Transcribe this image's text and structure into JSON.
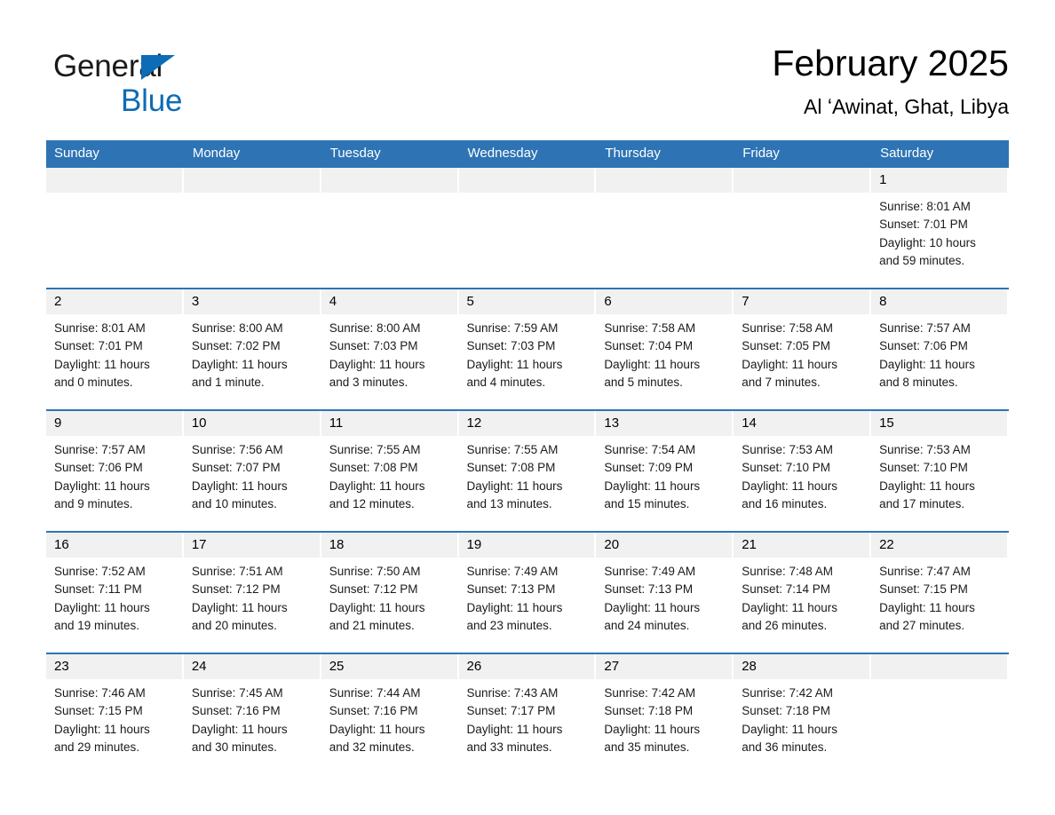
{
  "brand": {
    "name_part1": "General",
    "name_part2": "Blue",
    "triangle_color": "#0d6cb6",
    "accent_color": "#2e74b4"
  },
  "header": {
    "title": "February 2025",
    "subtitle": "Al ʻAwinat, Ghat, Libya"
  },
  "calendar": {
    "weekday_headers": [
      "Sunday",
      "Monday",
      "Tuesday",
      "Wednesday",
      "Thursday",
      "Friday",
      "Saturday"
    ],
    "labels": {
      "sunrise": "Sunrise:",
      "sunset": "Sunset:",
      "daylight": "Daylight:"
    },
    "weeks": [
      [
        {
          "empty": true
        },
        {
          "empty": true
        },
        {
          "empty": true
        },
        {
          "empty": true
        },
        {
          "empty": true
        },
        {
          "empty": true
        },
        {
          "day": "1",
          "sunrise": "Sunrise: 8:01 AM",
          "sunset": "Sunset: 7:01 PM",
          "daylight_line1": "Daylight: 10 hours",
          "daylight_line2": "and 59 minutes."
        }
      ],
      [
        {
          "day": "2",
          "sunrise": "Sunrise: 8:01 AM",
          "sunset": "Sunset: 7:01 PM",
          "daylight_line1": "Daylight: 11 hours",
          "daylight_line2": "and 0 minutes."
        },
        {
          "day": "3",
          "sunrise": "Sunrise: 8:00 AM",
          "sunset": "Sunset: 7:02 PM",
          "daylight_line1": "Daylight: 11 hours",
          "daylight_line2": "and 1 minute."
        },
        {
          "day": "4",
          "sunrise": "Sunrise: 8:00 AM",
          "sunset": "Sunset: 7:03 PM",
          "daylight_line1": "Daylight: 11 hours",
          "daylight_line2": "and 3 minutes."
        },
        {
          "day": "5",
          "sunrise": "Sunrise: 7:59 AM",
          "sunset": "Sunset: 7:03 PM",
          "daylight_line1": "Daylight: 11 hours",
          "daylight_line2": "and 4 minutes."
        },
        {
          "day": "6",
          "sunrise": "Sunrise: 7:58 AM",
          "sunset": "Sunset: 7:04 PM",
          "daylight_line1": "Daylight: 11 hours",
          "daylight_line2": "and 5 minutes."
        },
        {
          "day": "7",
          "sunrise": "Sunrise: 7:58 AM",
          "sunset": "Sunset: 7:05 PM",
          "daylight_line1": "Daylight: 11 hours",
          "daylight_line2": "and 7 minutes."
        },
        {
          "day": "8",
          "sunrise": "Sunrise: 7:57 AM",
          "sunset": "Sunset: 7:06 PM",
          "daylight_line1": "Daylight: 11 hours",
          "daylight_line2": "and 8 minutes."
        }
      ],
      [
        {
          "day": "9",
          "sunrise": "Sunrise: 7:57 AM",
          "sunset": "Sunset: 7:06 PM",
          "daylight_line1": "Daylight: 11 hours",
          "daylight_line2": "and 9 minutes."
        },
        {
          "day": "10",
          "sunrise": "Sunrise: 7:56 AM",
          "sunset": "Sunset: 7:07 PM",
          "daylight_line1": "Daylight: 11 hours",
          "daylight_line2": "and 10 minutes."
        },
        {
          "day": "11",
          "sunrise": "Sunrise: 7:55 AM",
          "sunset": "Sunset: 7:08 PM",
          "daylight_line1": "Daylight: 11 hours",
          "daylight_line2": "and 12 minutes."
        },
        {
          "day": "12",
          "sunrise": "Sunrise: 7:55 AM",
          "sunset": "Sunset: 7:08 PM",
          "daylight_line1": "Daylight: 11 hours",
          "daylight_line2": "and 13 minutes."
        },
        {
          "day": "13",
          "sunrise": "Sunrise: 7:54 AM",
          "sunset": "Sunset: 7:09 PM",
          "daylight_line1": "Daylight: 11 hours",
          "daylight_line2": "and 15 minutes."
        },
        {
          "day": "14",
          "sunrise": "Sunrise: 7:53 AM",
          "sunset": "Sunset: 7:10 PM",
          "daylight_line1": "Daylight: 11 hours",
          "daylight_line2": "and 16 minutes."
        },
        {
          "day": "15",
          "sunrise": "Sunrise: 7:53 AM",
          "sunset": "Sunset: 7:10 PM",
          "daylight_line1": "Daylight: 11 hours",
          "daylight_line2": "and 17 minutes."
        }
      ],
      [
        {
          "day": "16",
          "sunrise": "Sunrise: 7:52 AM",
          "sunset": "Sunset: 7:11 PM",
          "daylight_line1": "Daylight: 11 hours",
          "daylight_line2": "and 19 minutes."
        },
        {
          "day": "17",
          "sunrise": "Sunrise: 7:51 AM",
          "sunset": "Sunset: 7:12 PM",
          "daylight_line1": "Daylight: 11 hours",
          "daylight_line2": "and 20 minutes."
        },
        {
          "day": "18",
          "sunrise": "Sunrise: 7:50 AM",
          "sunset": "Sunset: 7:12 PM",
          "daylight_line1": "Daylight: 11 hours",
          "daylight_line2": "and 21 minutes."
        },
        {
          "day": "19",
          "sunrise": "Sunrise: 7:49 AM",
          "sunset": "Sunset: 7:13 PM",
          "daylight_line1": "Daylight: 11 hours",
          "daylight_line2": "and 23 minutes."
        },
        {
          "day": "20",
          "sunrise": "Sunrise: 7:49 AM",
          "sunset": "Sunset: 7:13 PM",
          "daylight_line1": "Daylight: 11 hours",
          "daylight_line2": "and 24 minutes."
        },
        {
          "day": "21",
          "sunrise": "Sunrise: 7:48 AM",
          "sunset": "Sunset: 7:14 PM",
          "daylight_line1": "Daylight: 11 hours",
          "daylight_line2": "and 26 minutes."
        },
        {
          "day": "22",
          "sunrise": "Sunrise: 7:47 AM",
          "sunset": "Sunset: 7:15 PM",
          "daylight_line1": "Daylight: 11 hours",
          "daylight_line2": "and 27 minutes."
        }
      ],
      [
        {
          "day": "23",
          "sunrise": "Sunrise: 7:46 AM",
          "sunset": "Sunset: 7:15 PM",
          "daylight_line1": "Daylight: 11 hours",
          "daylight_line2": "and 29 minutes."
        },
        {
          "day": "24",
          "sunrise": "Sunrise: 7:45 AM",
          "sunset": "Sunset: 7:16 PM",
          "daylight_line1": "Daylight: 11 hours",
          "daylight_line2": "and 30 minutes."
        },
        {
          "day": "25",
          "sunrise": "Sunrise: 7:44 AM",
          "sunset": "Sunset: 7:16 PM",
          "daylight_line1": "Daylight: 11 hours",
          "daylight_line2": "and 32 minutes."
        },
        {
          "day": "26",
          "sunrise": "Sunrise: 7:43 AM",
          "sunset": "Sunset: 7:17 PM",
          "daylight_line1": "Daylight: 11 hours",
          "daylight_line2": "and 33 minutes."
        },
        {
          "day": "27",
          "sunrise": "Sunrise: 7:42 AM",
          "sunset": "Sunset: 7:18 PM",
          "daylight_line1": "Daylight: 11 hours",
          "daylight_line2": "and 35 minutes."
        },
        {
          "day": "28",
          "sunrise": "Sunrise: 7:42 AM",
          "sunset": "Sunset: 7:18 PM",
          "daylight_line1": "Daylight: 11 hours",
          "daylight_line2": "and 36 minutes."
        },
        {
          "empty": true
        }
      ]
    ]
  }
}
